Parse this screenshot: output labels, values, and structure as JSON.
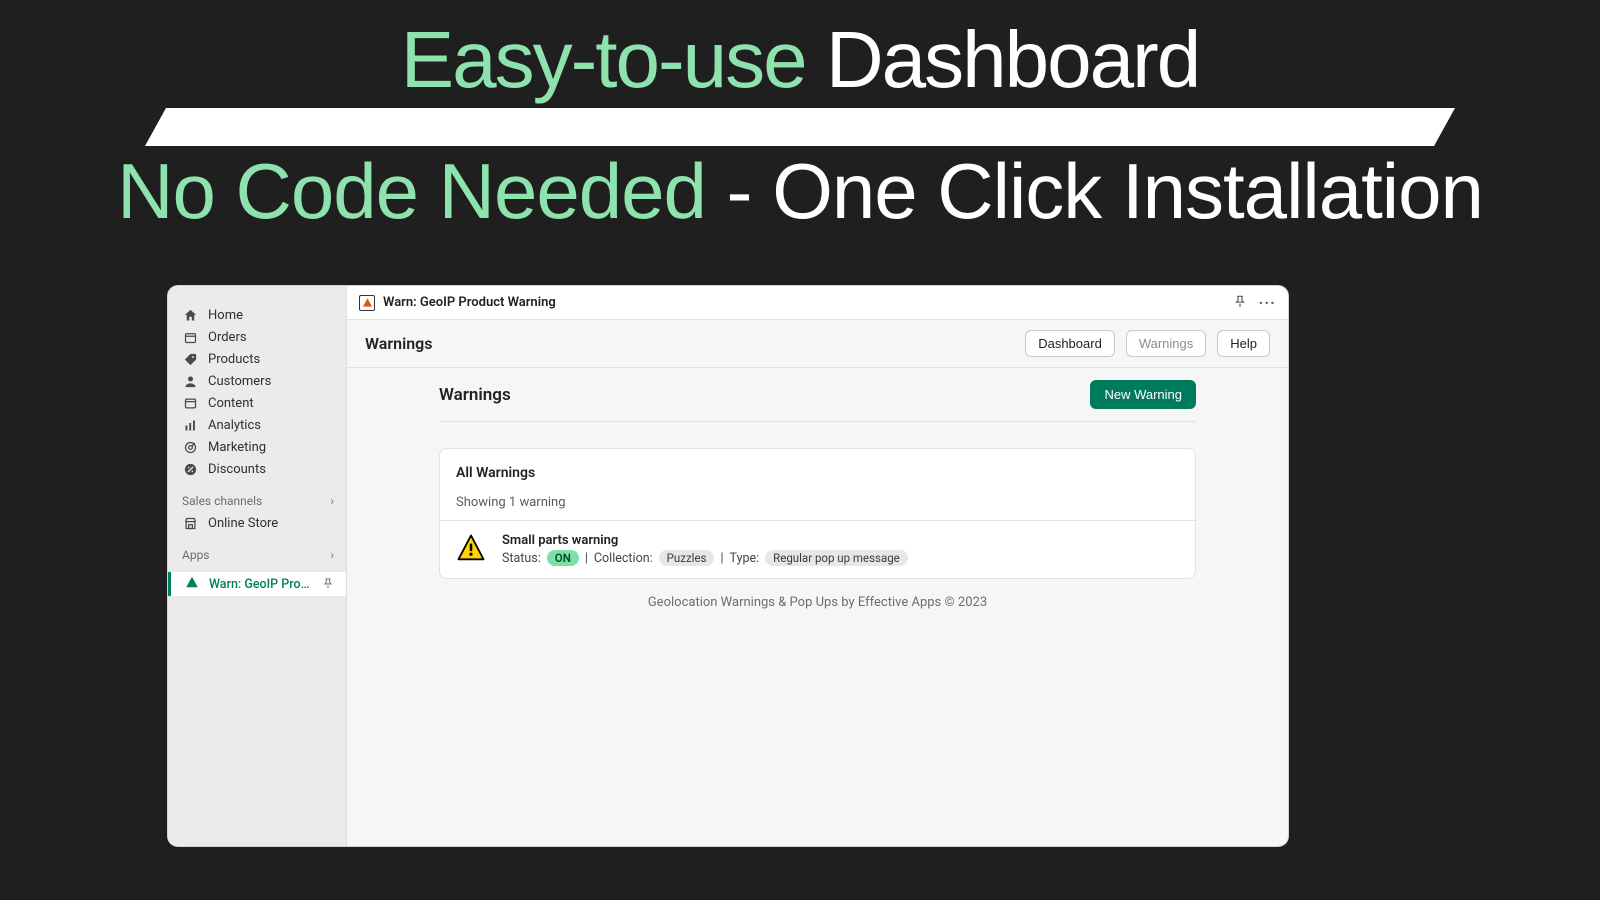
{
  "hero": {
    "line1_accent": "Easy-to-use",
    "line1_rest": "Dashboard",
    "line2_accent": "No Code Needed",
    "line2_sep": " - ",
    "line2_rest": "One Click Installation"
  },
  "appbar": {
    "title": "Warn: GeoIP Product Warning"
  },
  "sidebar": {
    "items": [
      {
        "label": "Home"
      },
      {
        "label": "Orders"
      },
      {
        "label": "Products"
      },
      {
        "label": "Customers"
      },
      {
        "label": "Content"
      },
      {
        "label": "Analytics"
      },
      {
        "label": "Marketing"
      },
      {
        "label": "Discounts"
      }
    ],
    "sales_header": "Sales channels",
    "sales_items": [
      {
        "label": "Online Store"
      }
    ],
    "apps_header": "Apps",
    "app_active": "Warn: GeoIP Produc..."
  },
  "page": {
    "header": "Warnings",
    "tabs": {
      "dashboard": "Dashboard",
      "warnings": "Warnings",
      "help": "Help"
    },
    "title": "Warnings",
    "new_btn": "New Warning"
  },
  "card": {
    "title": "All Warnings",
    "subtitle": "Showing 1 warning"
  },
  "warning": {
    "title": "Small parts warning",
    "status_label": "Status:",
    "status_value": "ON",
    "collection_label": "Collection:",
    "collection_value": "Puzzles",
    "type_label": "Type:",
    "type_value": "Regular pop up message",
    "sep": "|"
  },
  "footer": "Geolocation Warnings & Pop Ups by Effective Apps © 2023"
}
